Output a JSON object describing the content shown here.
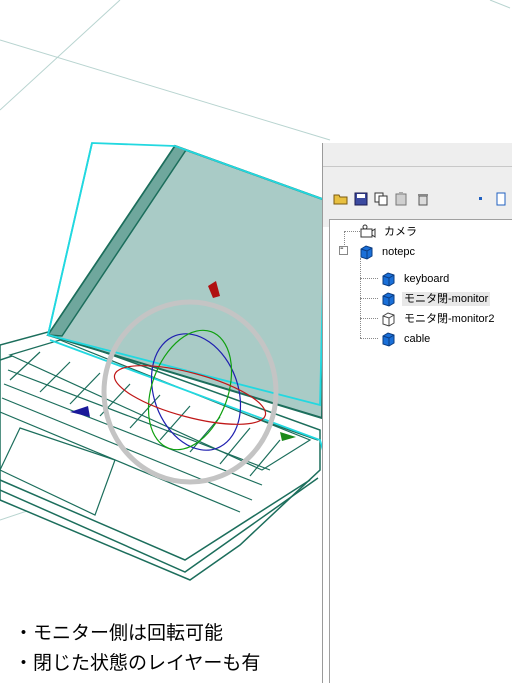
{
  "viewport": {
    "name": "3d-viewport",
    "colors": {
      "model": "#1c6e5c",
      "screen_fill": "#a9cbc6",
      "bbox": "#22d8e0",
      "gizmo_ring": "#c4c4c4"
    }
  },
  "toolbar": {
    "icons": [
      "open-folder-icon",
      "save-icon",
      "copy-icon",
      "paste-icon",
      "delete-icon",
      "dot-icon",
      "panel-icon"
    ]
  },
  "tree": {
    "camera": "カメラ",
    "root": "notepc",
    "collapse_glyph": "-",
    "children": [
      {
        "label": "keyboard",
        "icon": "cube-blue-icon"
      },
      {
        "label": "モニタ閉-monitor",
        "icon": "cube-blue-icon"
      },
      {
        "label": "モニタ閉-monitor2",
        "icon": "cube-outline-icon"
      },
      {
        "label": "cable",
        "icon": "cube-blue-icon"
      }
    ]
  },
  "notes": {
    "line1": "・モニター側は回転可能",
    "line2": "・閉じた状態のレイヤーも有"
  }
}
